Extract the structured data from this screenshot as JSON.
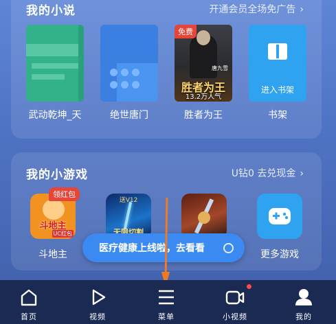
{
  "novels": {
    "title": "我的小说",
    "promo_link": "开通会员全场免广告",
    "books": [
      {
        "label": "武动乾坤_天"
      },
      {
        "label": "绝世唐门"
      },
      {
        "label": "胜者为王",
        "tag": "免费",
        "cover_title": "胜者为王",
        "cover_small": "唐九雪",
        "cover_reads": "13.2万人气"
      },
      {
        "label": "书架",
        "cover_text": "进入书架"
      }
    ]
  },
  "games": {
    "title": "我的小游戏",
    "link": "U钻0 去兑现金",
    "items": [
      {
        "label": "斗地主",
        "tag": "领红包",
        "cover_text": "斗地主",
        "cover_badge": "UC红包"
      },
      {
        "label": "",
        "cover_top": "送V12",
        "cover_text": "无限切割"
      },
      {
        "label": ""
      },
      {
        "label": "更多游戏"
      }
    ]
  },
  "toast": {
    "text": "医疗健康上线啦，去看看"
  },
  "tabbar": {
    "items": [
      {
        "label": "首页",
        "icon": "home-icon"
      },
      {
        "label": "视频",
        "icon": "play-icon"
      },
      {
        "label": "菜单",
        "icon": "menu-icon"
      },
      {
        "label": "小视频",
        "icon": "camera-icon"
      },
      {
        "label": "我的",
        "icon": "user-icon"
      }
    ]
  },
  "colors": {
    "accent": "#3b8af2",
    "tag_red": "#e64538",
    "arrow": "#f07a22",
    "tabbar_bg": "#1a2a52"
  }
}
